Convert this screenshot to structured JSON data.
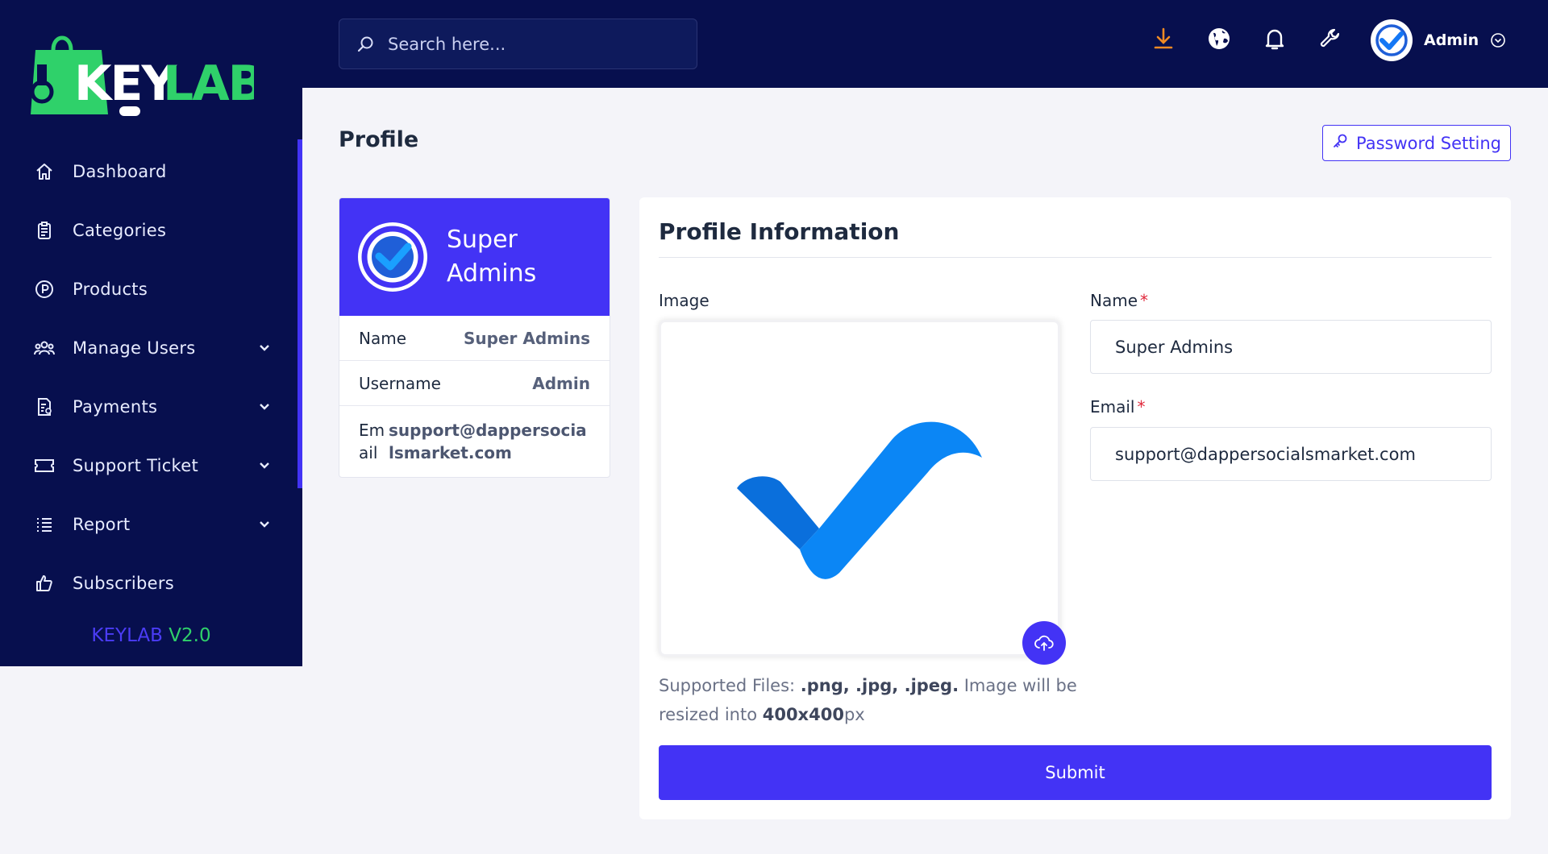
{
  "brand": {
    "logo_text": "KEYLAB",
    "version_brand": "KEYLAB",
    "version_number": "V2.0"
  },
  "sidebar": {
    "items": [
      {
        "label": "Dashboard",
        "icon": "home-icon"
      },
      {
        "label": "Categories",
        "icon": "clipboard-icon"
      },
      {
        "label": "Products",
        "icon": "p-circle-icon"
      },
      {
        "label": "Manage Users",
        "icon": "users-icon",
        "has_submenu": true
      },
      {
        "label": "Payments",
        "icon": "invoice-icon",
        "has_submenu": true
      },
      {
        "label": "Support Ticket",
        "icon": "ticket-icon",
        "has_submenu": true
      },
      {
        "label": "Report",
        "icon": "list-icon",
        "has_submenu": true
      },
      {
        "label": "Subscribers",
        "icon": "thumbs-up-icon"
      }
    ]
  },
  "topbar": {
    "search_placeholder": "Search here...",
    "icons": [
      "download-icon",
      "globe-icon",
      "bell-icon",
      "wrench-icon"
    ],
    "user_name": "Admin"
  },
  "page": {
    "title": "Profile",
    "password_button": "Password Setting"
  },
  "profile_card": {
    "display_name": "Super Admins",
    "rows": [
      {
        "label": "Name",
        "value": "Super Admins"
      },
      {
        "label": "Username",
        "value": "Admin"
      },
      {
        "label": "Email",
        "value": "support@dappersocialsmarket.com"
      }
    ]
  },
  "profile_form": {
    "title": "Profile Information",
    "image_label": "Image",
    "name_label": "Name",
    "name_value": "Super Admins",
    "email_label": "Email",
    "email_value": "support@dappersocialsmarket.com",
    "required_mark": "*",
    "hint_prefix": "Supported Files: ",
    "hint_files": ".png, .jpg, .jpeg.",
    "hint_middle": " Image will be resized into ",
    "hint_size": "400x400",
    "hint_suffix": "px",
    "submit_label": "Submit"
  },
  "colors": {
    "nav_bg": "#070f4e",
    "accent": "#4333f5",
    "logo_green": "#2fd16a",
    "download_orange": "#f08a24",
    "required_red": "#e0283b"
  }
}
